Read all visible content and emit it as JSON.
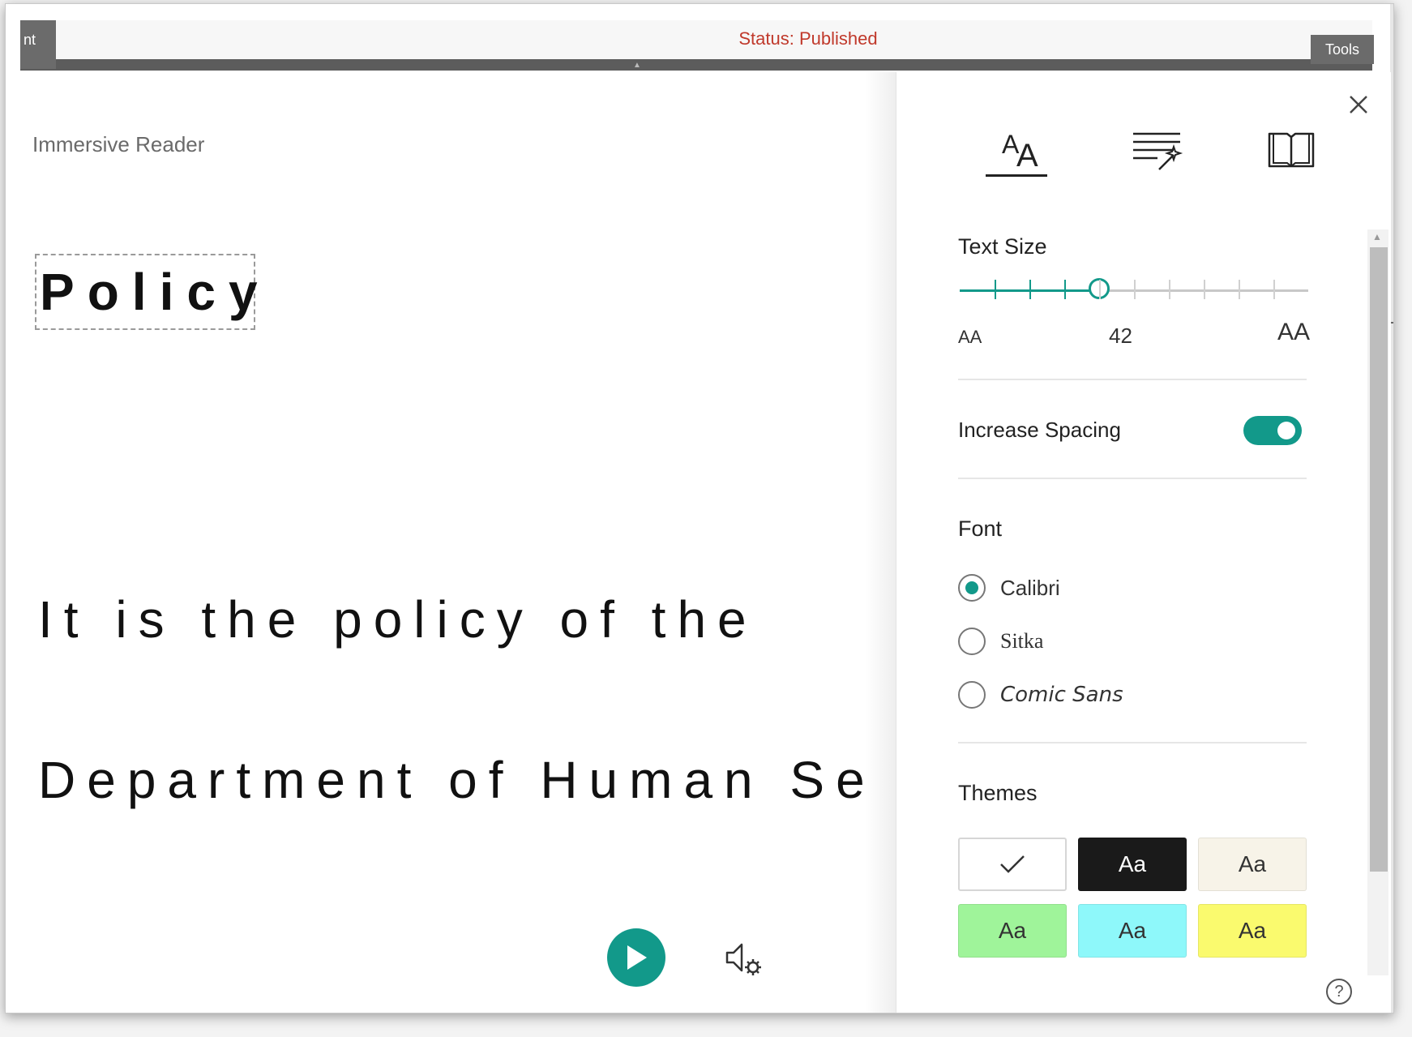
{
  "top": {
    "left_tab_label": "nt",
    "status": "Status: Published",
    "tools_label": "Tools"
  },
  "reader": {
    "app_label": "Immersive Reader",
    "heading": "Policy",
    "line1": "It is the policy of the",
    "line2": "Department of Human Se"
  },
  "panel": {
    "tabs": [
      {
        "name": "text-preferences",
        "icon": "text-size-icon",
        "active": true
      },
      {
        "name": "grammar-options",
        "icon": "grammar-magic-icon",
        "active": false
      },
      {
        "name": "reading-preferences",
        "icon": "book-icon",
        "active": false
      }
    ],
    "text_size": {
      "title": "Text Size",
      "value": "42",
      "small_glyph": "AA",
      "large_glyph": "AA",
      "level_fraction": 0.4
    },
    "spacing": {
      "label": "Increase Spacing",
      "enabled": true
    },
    "font": {
      "title": "Font",
      "options": [
        {
          "label": "Calibri",
          "checked": true
        },
        {
          "label": "Sitka",
          "checked": false
        },
        {
          "label": "Comic Sans",
          "checked": false
        }
      ]
    },
    "themes": {
      "title": "Themes",
      "sample": "Aa",
      "items": [
        {
          "bg": "#ffffff",
          "fg": "#333333",
          "selected": true
        },
        {
          "bg": "#1a1a1a",
          "fg": "#ffffff",
          "selected": false
        },
        {
          "bg": "#f7f3e8",
          "fg": "#333333",
          "selected": false
        },
        {
          "bg": "#9ff49a",
          "fg": "#333333",
          "selected": false
        },
        {
          "bg": "#8ef8fa",
          "fg": "#333333",
          "selected": false
        },
        {
          "bg": "#fafa6e",
          "fg": "#333333",
          "selected": false
        }
      ]
    },
    "help": "?"
  },
  "colors": {
    "accent": "#12998a",
    "status_red": "#c0392b"
  }
}
